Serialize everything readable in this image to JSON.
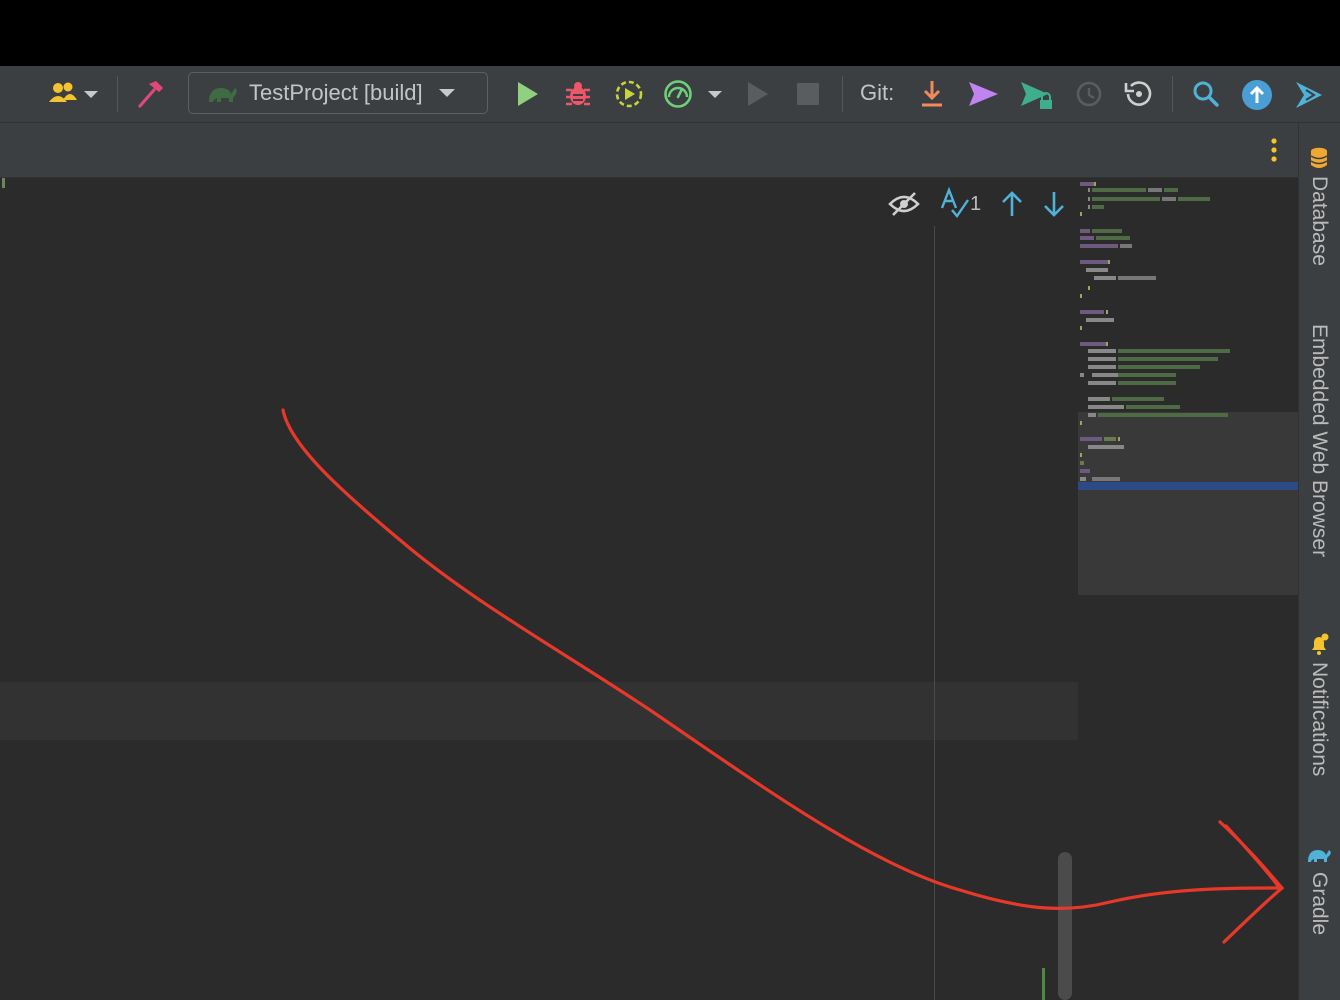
{
  "toolbar": {
    "users_icon": "users-icon",
    "build_icon": "hammer-icon",
    "run_config": {
      "label": "TestProject [build]",
      "icon": "gradle-elephant-icon"
    },
    "run_icon": "run-icon",
    "debug_icon": "bug-icon",
    "coverage_icon": "coverage-icon",
    "profile_icon": "profiler-icon",
    "git_label": "Git:",
    "colors": {
      "run": "#8fd17e",
      "debug": "#f0566a",
      "coverage": "#c8d43a",
      "profile": "#6fcf79",
      "update": "#f08a5d",
      "push": "#c083f0",
      "accent": "#4a9ed6"
    }
  },
  "editor": {
    "inspection_count": "1"
  },
  "side_panel": {
    "tabs": [
      {
        "label": "Database",
        "icon": "database-icon"
      },
      {
        "label": "Embedded Web Browser",
        "icon": ""
      },
      {
        "label": "Notifications",
        "icon": "bell-icon"
      },
      {
        "label": "Gradle",
        "icon": "gradle-elephant-icon"
      }
    ]
  },
  "annotation": {
    "color": "#e8382a",
    "description_icon": "red-arrow-to-gradle"
  }
}
